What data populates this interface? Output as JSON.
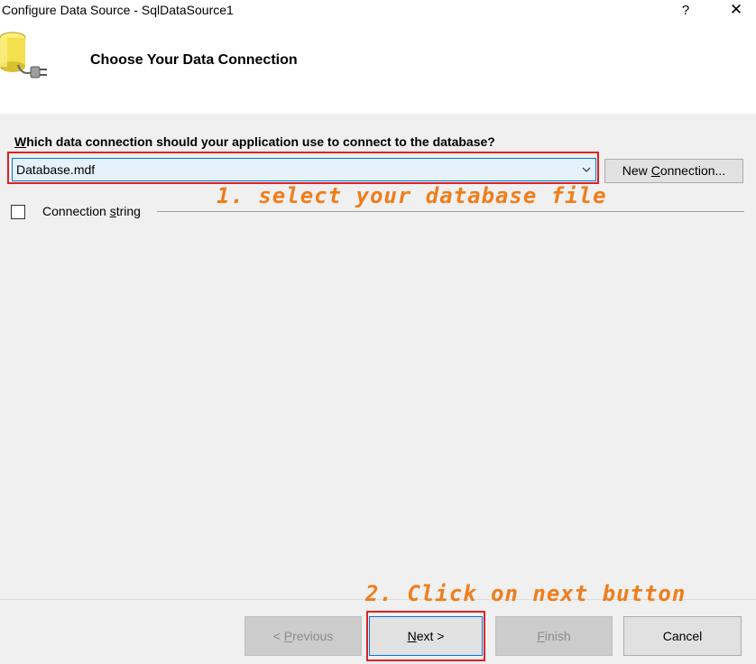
{
  "window": {
    "title": "Configure Data Source - SqlDataSource1",
    "help_glyph": "?",
    "close_glyph": "✕"
  },
  "header": {
    "title": "Choose Your Data Connection",
    "icon": "database-plug-icon"
  },
  "connection": {
    "question_prefix": "W",
    "question_rest": "hich data connection should your application use to connect to the database?",
    "selected_value": "Database.mdf",
    "new_button_pre": "New ",
    "new_button_u": "C",
    "new_button_post": "onnection..."
  },
  "connection_string": {
    "label_pre": "Connection ",
    "label_u": "s",
    "label_post": "tring",
    "checked": false
  },
  "annotations": {
    "step1": "1. select your database file",
    "step2": "2. Click on next button"
  },
  "footer": {
    "previous_pre": "< ",
    "previous_u": "P",
    "previous_post": "revious",
    "next_u": "N",
    "next_post": "ext >",
    "finish_u": "F",
    "finish_post": "inish",
    "cancel": "Cancel"
  },
  "colors": {
    "annotation": "#f07d1a",
    "highlight_box": "#e02020",
    "focus_border": "#0078d7"
  }
}
